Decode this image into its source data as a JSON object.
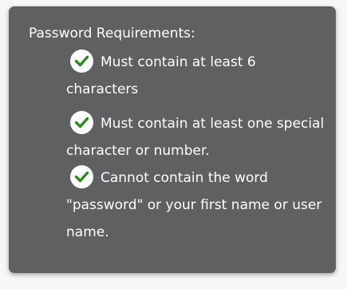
{
  "tooltip": {
    "title": "Password Requirements:",
    "check_color": "#2e8b22",
    "requirements": [
      {
        "text": "Must contain at least 6 characters",
        "icon": "check-circle-icon",
        "met": true
      },
      {
        "text": "Must contain at least one special character or number.",
        "icon": "check-circle-icon",
        "met": true
      },
      {
        "text": "Cannot contain the word \"password\" or your first name or user name.",
        "icon": "check-circle-icon",
        "met": true
      }
    ]
  }
}
